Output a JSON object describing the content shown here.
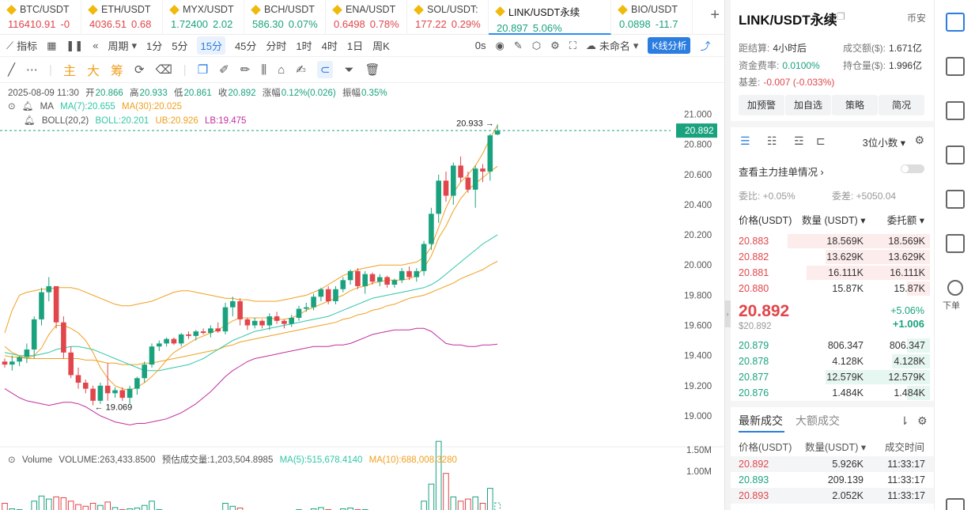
{
  "tabs": [
    {
      "name": "BTC/USDT",
      "price": "116410.91",
      "change": "-0",
      "dir": "down"
    },
    {
      "name": "ETH/USDT",
      "price": "4036.51",
      "change": "0.68",
      "dir": "down"
    },
    {
      "name": "MYX/USDT",
      "price": "1.72400",
      "change": "2.02",
      "dir": "up"
    },
    {
      "name": "BCH/USDT",
      "price": "586.30",
      "change": "0.07%",
      "dir": "up"
    },
    {
      "name": "ENA/USDT",
      "price": "0.6498",
      "change": "0.78%",
      "dir": "down"
    },
    {
      "name": "SOL/USDT:",
      "price": "177.22",
      "change": "0.29%",
      "dir": "down"
    },
    {
      "name": "LINK/USDT永续",
      "price": "20.897",
      "change": "5.06%",
      "dir": "up",
      "active": true
    },
    {
      "name": "BIO/USDT",
      "price": "0.0898",
      "change": "-11.7",
      "dir": "up"
    }
  ],
  "toolbar": {
    "indicator": "指标",
    "period": "周期",
    "intervals": [
      "1分",
      "5分",
      "15分",
      "45分",
      "分时",
      "1时",
      "4时",
      "1日",
      "周K"
    ],
    "selected_interval": "15分",
    "seconds": "0s",
    "unnamed": "未命名",
    "kline_analysis": "K线分析"
  },
  "drawtools": {
    "zhu": "主",
    "da": "大",
    "chou": "筹"
  },
  "chart": {
    "info_line": {
      "datetime": "2025-08-09 11:30",
      "open_lbl": "开",
      "open": "20.866",
      "high_lbl": "高",
      "high": "20.933",
      "low_lbl": "低",
      "low": "20.861",
      "close_lbl": "收",
      "close": "20.892",
      "chg_lbl": "涨幅",
      "chg": "0.12%(0.026)",
      "amp_lbl": "振幅",
      "amp": "0.35%"
    },
    "ma": {
      "label": "MA",
      "ma7": "MA(7):20.655",
      "ma30": "MA(30):20.025"
    },
    "boll": {
      "label": "BOLL(20,2)",
      "mid": "BOLL:20.201",
      "ub": "UB:20.926",
      "lb": "LB:19.475"
    },
    "price_ticks": [
      "21.000",
      "20.800",
      "20.600",
      "20.400",
      "20.200",
      "20.000",
      "19.800",
      "19.600",
      "19.400",
      "19.200",
      "19.000"
    ],
    "current_price": "20.892",
    "high_label": "20.933 →",
    "low_label": "← 19.069",
    "volume": {
      "label": "Volume",
      "volume": "VOLUME:263,433.8500",
      "est": "预估成交量:1,203,504.8985",
      "ma5": "MA(5):515,678.4140",
      "ma10": "MA(10):688,008.3280"
    },
    "volume_ticks": [
      "1.50M",
      "1.00M"
    ],
    "colors": {
      "up": "#1aa27f",
      "down": "#e0464b",
      "ma7": "#f0a020",
      "ma30": "#f0a020",
      "boll_mid": "#2fc7a8",
      "boll_lb": "#c02fa0"
    }
  },
  "chart_data": {
    "type": "candlestick",
    "ylim": [
      18.9,
      21.05
    ],
    "candles": [
      [
        19.36,
        19.38,
        19.32,
        19.34
      ],
      [
        19.34,
        19.4,
        19.3,
        19.36
      ],
      [
        19.36,
        19.4,
        19.33,
        19.39
      ],
      [
        19.39,
        19.48,
        19.35,
        19.44
      ],
      [
        19.44,
        19.66,
        19.38,
        19.64
      ],
      [
        19.64,
        19.85,
        19.6,
        19.82
      ],
      [
        19.82,
        19.92,
        19.76,
        19.86
      ],
      [
        19.86,
        19.84,
        19.58,
        19.62
      ],
      [
        19.62,
        19.66,
        19.38,
        19.42
      ],
      [
        19.42,
        19.46,
        19.25,
        19.27
      ],
      [
        19.27,
        19.32,
        19.18,
        19.22
      ],
      [
        19.22,
        19.24,
        19.15,
        19.18
      ],
      [
        19.18,
        19.2,
        19.07,
        19.1
      ],
      [
        19.1,
        19.22,
        19.08,
        19.2
      ],
      [
        19.2,
        19.35,
        19.1,
        19.15
      ],
      [
        19.15,
        19.19,
        19.12,
        19.17
      ],
      [
        19.17,
        19.19,
        19.1,
        19.12
      ],
      [
        19.12,
        19.2,
        19.08,
        19.18
      ],
      [
        19.18,
        19.26,
        19.14,
        19.25
      ],
      [
        19.25,
        19.36,
        19.22,
        19.34
      ],
      [
        19.34,
        19.48,
        19.32,
        19.46
      ],
      [
        19.46,
        19.5,
        19.43,
        19.48
      ],
      [
        19.48,
        19.52,
        19.46,
        19.51
      ],
      [
        19.51,
        19.52,
        19.47,
        19.48
      ],
      [
        19.48,
        19.55,
        19.46,
        19.54
      ],
      [
        19.54,
        19.56,
        19.51,
        19.53
      ],
      [
        19.53,
        19.57,
        19.5,
        19.56
      ],
      [
        19.56,
        19.58,
        19.54,
        19.55
      ],
      [
        19.55,
        19.6,
        19.52,
        19.58
      ],
      [
        19.58,
        19.62,
        19.55,
        19.56
      ],
      [
        19.56,
        19.75,
        19.54,
        19.72
      ],
      [
        19.72,
        19.79,
        19.66,
        19.76
      ],
      [
        19.76,
        19.78,
        19.6,
        19.64
      ],
      [
        19.64,
        19.65,
        19.57,
        19.6
      ],
      [
        19.6,
        19.65,
        19.58,
        19.63
      ],
      [
        19.63,
        19.64,
        19.58,
        19.6
      ],
      [
        19.6,
        19.68,
        19.57,
        19.66
      ],
      [
        19.66,
        19.69,
        19.61,
        19.63
      ],
      [
        19.63,
        19.64,
        19.58,
        19.61
      ],
      [
        19.61,
        19.67,
        19.59,
        19.65
      ],
      [
        19.65,
        19.73,
        19.63,
        19.71
      ],
      [
        19.71,
        19.75,
        19.69,
        19.72
      ],
      [
        19.72,
        19.81,
        19.7,
        19.79
      ],
      [
        19.79,
        19.85,
        19.76,
        19.84
      ],
      [
        19.84,
        19.86,
        19.74,
        19.76
      ],
      [
        19.76,
        19.86,
        19.74,
        19.84
      ],
      [
        19.84,
        19.92,
        19.82,
        19.9
      ],
      [
        19.9,
        19.97,
        19.87,
        19.96
      ],
      [
        19.96,
        19.98,
        19.84,
        19.86
      ],
      [
        19.86,
        19.96,
        19.81,
        19.94
      ],
      [
        19.94,
        19.95,
        19.87,
        19.89
      ],
      [
        19.89,
        19.94,
        19.86,
        19.92
      ],
      [
        19.92,
        19.93,
        19.85,
        19.87
      ],
      [
        19.87,
        19.91,
        19.85,
        19.9
      ],
      [
        19.9,
        19.98,
        19.88,
        19.96
      ],
      [
        19.96,
        19.99,
        19.9,
        19.92
      ],
      [
        19.92,
        19.98,
        19.89,
        19.96
      ],
      [
        19.96,
        20.16,
        19.93,
        20.14
      ],
      [
        20.14,
        20.38,
        20.1,
        20.34
      ],
      [
        20.34,
        20.6,
        20.28,
        20.56
      ],
      [
        20.56,
        20.62,
        20.42,
        20.46
      ],
      [
        20.46,
        20.68,
        20.4,
        20.66
      ],
      [
        20.66,
        20.72,
        20.55,
        20.58
      ],
      [
        20.58,
        20.62,
        20.48,
        20.5
      ],
      [
        20.5,
        20.66,
        20.38,
        20.64
      ],
      [
        20.64,
        20.67,
        20.55,
        20.62
      ],
      [
        20.62,
        20.87,
        20.56,
        20.86
      ],
      [
        20.866,
        20.933,
        20.861,
        20.892
      ]
    ],
    "ma7": [
      19.46,
      19.42,
      19.4,
      19.38,
      19.4,
      19.45,
      19.54,
      19.6,
      19.6,
      19.58,
      19.55,
      19.5,
      19.42,
      19.32,
      19.25,
      19.2,
      19.18,
      19.17,
      19.19,
      19.22,
      19.26,
      19.31,
      19.37,
      19.42,
      19.45,
      19.48,
      19.51,
      19.53,
      19.55,
      19.57,
      19.6,
      19.63,
      19.65,
      19.65,
      19.65,
      19.65,
      19.65,
      19.64,
      19.64,
      19.65,
      19.67,
      19.7,
      19.72,
      19.74,
      19.76,
      19.78,
      19.8,
      19.83,
      19.85,
      19.86,
      19.88,
      19.89,
      19.9,
      19.9,
      19.9,
      19.91,
      19.93,
      19.98,
      20.06,
      20.18,
      20.26,
      20.36,
      20.44,
      20.5,
      20.54,
      20.58,
      20.62,
      20.655
    ],
    "boll_mid": [
      19.42,
      19.41,
      19.4,
      19.4,
      19.4,
      19.41,
      19.42,
      19.44,
      19.45,
      19.46,
      19.46,
      19.45,
      19.44,
      19.42,
      19.4,
      19.38,
      19.36,
      19.34,
      19.32,
      19.3,
      19.3,
      19.3,
      19.31,
      19.32,
      19.33,
      19.34,
      19.36,
      19.38,
      19.41,
      19.44,
      19.47,
      19.5,
      19.52,
      19.54,
      19.56,
      19.57,
      19.58,
      19.59,
      19.6,
      19.61,
      19.62,
      19.63,
      19.64,
      19.65,
      19.66,
      19.68,
      19.7,
      19.72,
      19.74,
      19.76,
      19.78,
      19.79,
      19.8,
      19.81,
      19.82,
      19.83,
      19.84,
      19.85,
      19.87,
      19.9,
      19.94,
      19.98,
      20.02,
      20.06,
      20.1,
      20.14,
      20.17,
      20.201
    ],
    "ma30": [
      19.4,
      19.39,
      19.39,
      19.38,
      19.38,
      19.38,
      19.38,
      19.38,
      19.38,
      19.38,
      19.38,
      19.37,
      19.37,
      19.36,
      19.35,
      19.35,
      19.34,
      19.34,
      19.34,
      19.35,
      19.35,
      19.36,
      19.37,
      19.38,
      19.39,
      19.4,
      19.41,
      19.42,
      19.43,
      19.44,
      19.46,
      19.47,
      19.49,
      19.5,
      19.51,
      19.52,
      19.53,
      19.54,
      19.55,
      19.56,
      19.57,
      19.58,
      19.59,
      19.6,
      19.61,
      19.62,
      19.64,
      19.65,
      19.67,
      19.68,
      19.7,
      19.71,
      19.73,
      19.74,
      19.76,
      19.78,
      19.79,
      19.8,
      19.82,
      19.84,
      19.86,
      19.88,
      19.91,
      19.93,
      19.95,
      19.97,
      20.0,
      20.025
    ],
    "ub": [
      19.55,
      19.7,
      19.8,
      19.82,
      19.83,
      19.84,
      19.84,
      19.85,
      19.85,
      19.85,
      19.84,
      19.82,
      19.8,
      19.78,
      19.76,
      19.74,
      19.73,
      19.73,
      19.74,
      19.75,
      19.76,
      19.78,
      19.8,
      19.82,
      19.83,
      19.83,
      19.82,
      19.81,
      19.8,
      19.79,
      19.78,
      19.78,
      19.77,
      19.77,
      19.76,
      19.76,
      19.76,
      19.76,
      19.77,
      19.78,
      19.79,
      19.8,
      19.82,
      19.84,
      19.87,
      19.9,
      19.93,
      19.95,
      19.97,
      19.98,
      19.99,
      20.0,
      20.0,
      20.0,
      20.0,
      20.01,
      20.02,
      20.05,
      20.12,
      20.25,
      20.38,
      20.48,
      20.55,
      20.6,
      20.66,
      20.74,
      20.84,
      20.926
    ],
    "lb": [
      19.18,
      19.15,
      19.12,
      19.1,
      19.09,
      19.08,
      19.07,
      19.08,
      19.09,
      19.09,
      19.08,
      19.06,
      19.03,
      19.0,
      18.98,
      18.96,
      18.95,
      18.94,
      18.95,
      18.95,
      18.96,
      18.97,
      18.98,
      19.0,
      19.02,
      19.05,
      19.08,
      19.12,
      19.16,
      19.21,
      19.26,
      19.3,
      19.33,
      19.36,
      19.38,
      19.39,
      19.4,
      19.41,
      19.42,
      19.43,
      19.44,
      19.45,
      19.46,
      19.46,
      19.46,
      19.47,
      19.47,
      19.48,
      19.5,
      19.52,
      19.54,
      19.55,
      19.56,
      19.57,
      19.57,
      19.57,
      19.58,
      19.58,
      19.56,
      19.52,
      19.48,
      19.47,
      19.47,
      19.46,
      19.46,
      19.47,
      19.47,
      19.475
    ],
    "volume": [
      0.25,
      0.12,
      0.1,
      0.08,
      0.3,
      0.42,
      0.35,
      0.4,
      0.38,
      0.3,
      0.22,
      0.18,
      0.25,
      0.2,
      0.28,
      0.15,
      0.1,
      0.12,
      0.14,
      0.2,
      0.3,
      0.1,
      0.08,
      0.06,
      0.05,
      0.07,
      0.06,
      0.05,
      0.05,
      0.04,
      0.25,
      0.18,
      0.14,
      0.08,
      0.06,
      0.05,
      0.06,
      0.05,
      0.04,
      0.06,
      0.1,
      0.06,
      0.12,
      0.15,
      0.1,
      0.08,
      0.12,
      0.14,
      0.1,
      0.1,
      0.08,
      0.06,
      0.08,
      0.06,
      0.07,
      0.08,
      0.06,
      0.3,
      0.7,
      1.7,
      0.95,
      0.4,
      0.3,
      0.35,
      0.4,
      0.25,
      0.6,
      0.26
    ]
  },
  "panel": {
    "title": "LINK/USDT永续",
    "exchange": "币安",
    "settle_lbl": "距结算:",
    "settle": "4小时后",
    "turnover_lbl": "成交额($):",
    "turnover": "1.671亿",
    "funding_lbl": "资金费率:",
    "funding": "0.0100%",
    "oi_lbl": "持仓量($):",
    "oi": "1.996亿",
    "basis_lbl": "基差:",
    "basis": "-0.007 (-0.033%)",
    "buttons": [
      "加预警",
      "加自选",
      "策略",
      "简况"
    ],
    "decimals": "3位小数",
    "mainforce": "查看主力挂单情况",
    "ratio": "委比: +0.05%",
    "diff": "委差: +5050.04",
    "ob_headers": {
      "price": "价格(USDT)",
      "qty": "数量 (USDT)",
      "total": "委托额"
    },
    "asks": [
      {
        "price": "20.883",
        "qty": "18.569K",
        "total": "18.569K",
        "fill": 0.75
      },
      {
        "price": "20.882",
        "qty": "13.629K",
        "total": "13.629K",
        "fill": 0.55
      },
      {
        "price": "20.881",
        "qty": "16.111K",
        "total": "16.111K",
        "fill": 0.65
      },
      {
        "price": "20.880",
        "qty": "15.87K",
        "total": "15.87K",
        "fill": 0.12
      }
    ],
    "current": {
      "price": "20.892",
      "usd": "$20.892",
      "pct": "+5.06%",
      "chg": "+1.006"
    },
    "bids": [
      {
        "price": "20.879",
        "qty": "806.347",
        "total": "806.347",
        "fill": 0.12
      },
      {
        "price": "20.878",
        "qty": "4.128K",
        "total": "4.128K",
        "fill": 0.2
      },
      {
        "price": "20.877",
        "qty": "12.579K",
        "total": "12.579K",
        "fill": 0.55
      },
      {
        "price": "20.876",
        "qty": "1.484K",
        "total": "1.484K",
        "fill": 0.12
      }
    ],
    "trades_tabs": [
      "最新成交",
      "大额成交"
    ],
    "trade_headers": {
      "price": "价格(USDT)",
      "qty": "数量(USDT)",
      "time": "成交时间"
    },
    "trades": [
      {
        "price": "20.892",
        "qty": "5.926K",
        "time": "11:33:17",
        "dir": "down"
      },
      {
        "price": "20.893",
        "qty": "209.139",
        "time": "11:33:17",
        "dir": "up"
      },
      {
        "price": "20.893",
        "qty": "2.052K",
        "time": "11:33:17",
        "dir": "down"
      }
    ]
  },
  "sidebar": {
    "order_label": "下单"
  }
}
